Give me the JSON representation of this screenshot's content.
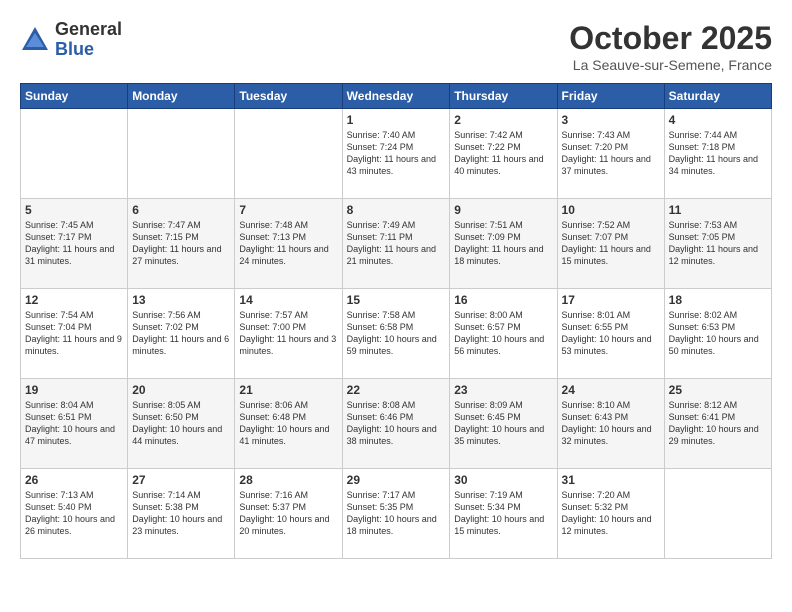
{
  "header": {
    "logo_general": "General",
    "logo_blue": "Blue",
    "month_title": "October 2025",
    "location": "La Seauve-sur-Semene, France"
  },
  "weekdays": [
    "Sunday",
    "Monday",
    "Tuesday",
    "Wednesday",
    "Thursday",
    "Friday",
    "Saturday"
  ],
  "weeks": [
    [
      {
        "day": "",
        "info": ""
      },
      {
        "day": "",
        "info": ""
      },
      {
        "day": "",
        "info": ""
      },
      {
        "day": "1",
        "info": "Sunrise: 7:40 AM\nSunset: 7:24 PM\nDaylight: 11 hours\nand 43 minutes."
      },
      {
        "day": "2",
        "info": "Sunrise: 7:42 AM\nSunset: 7:22 PM\nDaylight: 11 hours\nand 40 minutes."
      },
      {
        "day": "3",
        "info": "Sunrise: 7:43 AM\nSunset: 7:20 PM\nDaylight: 11 hours\nand 37 minutes."
      },
      {
        "day": "4",
        "info": "Sunrise: 7:44 AM\nSunset: 7:18 PM\nDaylight: 11 hours\nand 34 minutes."
      }
    ],
    [
      {
        "day": "5",
        "info": "Sunrise: 7:45 AM\nSunset: 7:17 PM\nDaylight: 11 hours\nand 31 minutes."
      },
      {
        "day": "6",
        "info": "Sunrise: 7:47 AM\nSunset: 7:15 PM\nDaylight: 11 hours\nand 27 minutes."
      },
      {
        "day": "7",
        "info": "Sunrise: 7:48 AM\nSunset: 7:13 PM\nDaylight: 11 hours\nand 24 minutes."
      },
      {
        "day": "8",
        "info": "Sunrise: 7:49 AM\nSunset: 7:11 PM\nDaylight: 11 hours\nand 21 minutes."
      },
      {
        "day": "9",
        "info": "Sunrise: 7:51 AM\nSunset: 7:09 PM\nDaylight: 11 hours\nand 18 minutes."
      },
      {
        "day": "10",
        "info": "Sunrise: 7:52 AM\nSunset: 7:07 PM\nDaylight: 11 hours\nand 15 minutes."
      },
      {
        "day": "11",
        "info": "Sunrise: 7:53 AM\nSunset: 7:05 PM\nDaylight: 11 hours\nand 12 minutes."
      }
    ],
    [
      {
        "day": "12",
        "info": "Sunrise: 7:54 AM\nSunset: 7:04 PM\nDaylight: 11 hours\nand 9 minutes."
      },
      {
        "day": "13",
        "info": "Sunrise: 7:56 AM\nSunset: 7:02 PM\nDaylight: 11 hours\nand 6 minutes."
      },
      {
        "day": "14",
        "info": "Sunrise: 7:57 AM\nSunset: 7:00 PM\nDaylight: 11 hours\nand 3 minutes."
      },
      {
        "day": "15",
        "info": "Sunrise: 7:58 AM\nSunset: 6:58 PM\nDaylight: 10 hours\nand 59 minutes."
      },
      {
        "day": "16",
        "info": "Sunrise: 8:00 AM\nSunset: 6:57 PM\nDaylight: 10 hours\nand 56 minutes."
      },
      {
        "day": "17",
        "info": "Sunrise: 8:01 AM\nSunset: 6:55 PM\nDaylight: 10 hours\nand 53 minutes."
      },
      {
        "day": "18",
        "info": "Sunrise: 8:02 AM\nSunset: 6:53 PM\nDaylight: 10 hours\nand 50 minutes."
      }
    ],
    [
      {
        "day": "19",
        "info": "Sunrise: 8:04 AM\nSunset: 6:51 PM\nDaylight: 10 hours\nand 47 minutes."
      },
      {
        "day": "20",
        "info": "Sunrise: 8:05 AM\nSunset: 6:50 PM\nDaylight: 10 hours\nand 44 minutes."
      },
      {
        "day": "21",
        "info": "Sunrise: 8:06 AM\nSunset: 6:48 PM\nDaylight: 10 hours\nand 41 minutes."
      },
      {
        "day": "22",
        "info": "Sunrise: 8:08 AM\nSunset: 6:46 PM\nDaylight: 10 hours\nand 38 minutes."
      },
      {
        "day": "23",
        "info": "Sunrise: 8:09 AM\nSunset: 6:45 PM\nDaylight: 10 hours\nand 35 minutes."
      },
      {
        "day": "24",
        "info": "Sunrise: 8:10 AM\nSunset: 6:43 PM\nDaylight: 10 hours\nand 32 minutes."
      },
      {
        "day": "25",
        "info": "Sunrise: 8:12 AM\nSunset: 6:41 PM\nDaylight: 10 hours\nand 29 minutes."
      }
    ],
    [
      {
        "day": "26",
        "info": "Sunrise: 7:13 AM\nSunset: 5:40 PM\nDaylight: 10 hours\nand 26 minutes."
      },
      {
        "day": "27",
        "info": "Sunrise: 7:14 AM\nSunset: 5:38 PM\nDaylight: 10 hours\nand 23 minutes."
      },
      {
        "day": "28",
        "info": "Sunrise: 7:16 AM\nSunset: 5:37 PM\nDaylight: 10 hours\nand 20 minutes."
      },
      {
        "day": "29",
        "info": "Sunrise: 7:17 AM\nSunset: 5:35 PM\nDaylight: 10 hours\nand 18 minutes."
      },
      {
        "day": "30",
        "info": "Sunrise: 7:19 AM\nSunset: 5:34 PM\nDaylight: 10 hours\nand 15 minutes."
      },
      {
        "day": "31",
        "info": "Sunrise: 7:20 AM\nSunset: 5:32 PM\nDaylight: 10 hours\nand 12 minutes."
      },
      {
        "day": "",
        "info": ""
      }
    ]
  ]
}
